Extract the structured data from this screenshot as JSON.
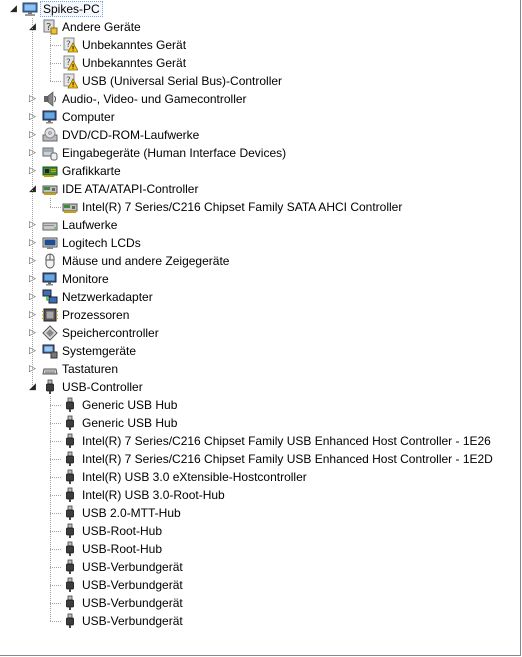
{
  "root": {
    "label": "Spikes-PC",
    "icon": "computer-icon"
  },
  "categories": [
    {
      "label": "Andere Geräte",
      "icon": "unknown-device-icon",
      "expanded": true,
      "children": [
        {
          "label": "Unbekanntes Gerät",
          "icon": "warning-device-icon"
        },
        {
          "label": "Unbekanntes Gerät",
          "icon": "warning-device-icon"
        },
        {
          "label": "USB (Universal Serial Bus)-Controller",
          "icon": "warning-device-icon"
        }
      ]
    },
    {
      "label": "Audio-, Video- und Gamecontroller",
      "icon": "speaker-icon",
      "expanded": false
    },
    {
      "label": "Computer",
      "icon": "monitor-icon",
      "expanded": false
    },
    {
      "label": "DVD/CD-ROM-Laufwerke",
      "icon": "dvd-drive-icon",
      "expanded": false
    },
    {
      "label": "Eingabegeräte (Human Interface Devices)",
      "icon": "hid-icon",
      "expanded": false
    },
    {
      "label": "Grafikkarte",
      "icon": "display-adapter-icon",
      "expanded": false
    },
    {
      "label": "IDE ATA/ATAPI-Controller",
      "icon": "ide-controller-icon",
      "expanded": true,
      "children": [
        {
          "label": "Intel(R) 7 Series/C216 Chipset Family SATA AHCI Controller",
          "icon": "ide-controller-icon"
        }
      ]
    },
    {
      "label": "Laufwerke",
      "icon": "disk-drive-icon",
      "expanded": false
    },
    {
      "label": "Logitech LCDs",
      "icon": "lcd-icon",
      "expanded": false
    },
    {
      "label": "Mäuse und andere Zeigegeräte",
      "icon": "mouse-icon",
      "expanded": false
    },
    {
      "label": "Monitore",
      "icon": "monitor-icon",
      "expanded": false
    },
    {
      "label": "Netzwerkadapter",
      "icon": "network-adapter-icon",
      "expanded": false
    },
    {
      "label": "Prozessoren",
      "icon": "processor-icon",
      "expanded": false
    },
    {
      "label": "Speichercontroller",
      "icon": "storage-controller-icon",
      "expanded": false
    },
    {
      "label": "Systemgeräte",
      "icon": "system-device-icon",
      "expanded": false
    },
    {
      "label": "Tastaturen",
      "icon": "keyboard-icon",
      "expanded": false
    },
    {
      "label": "USB-Controller",
      "icon": "usb-plug-icon",
      "expanded": true,
      "children": [
        {
          "label": "Generic USB Hub",
          "icon": "usb-plug-icon"
        },
        {
          "label": "Generic USB Hub",
          "icon": "usb-plug-icon"
        },
        {
          "label": "Intel(R) 7 Series/C216 Chipset Family USB Enhanced Host Controller - 1E26",
          "icon": "usb-plug-icon"
        },
        {
          "label": "Intel(R) 7 Series/C216 Chipset Family USB Enhanced Host Controller - 1E2D",
          "icon": "usb-plug-icon"
        },
        {
          "label": "Intel(R) USB 3.0 eXtensible-Hostcontroller",
          "icon": "usb-plug-icon"
        },
        {
          "label": "Intel(R) USB 3.0-Root-Hub",
          "icon": "usb-plug-icon"
        },
        {
          "label": "USB 2.0-MTT-Hub",
          "icon": "usb-plug-icon"
        },
        {
          "label": "USB-Root-Hub",
          "icon": "usb-plug-icon"
        },
        {
          "label": "USB-Root-Hub",
          "icon": "usb-plug-icon"
        },
        {
          "label": "USB-Verbundgerät",
          "icon": "usb-plug-icon"
        },
        {
          "label": "USB-Verbundgerät",
          "icon": "usb-plug-icon"
        },
        {
          "label": "USB-Verbundgerät",
          "icon": "usb-plug-icon"
        },
        {
          "label": "USB-Verbundgerät",
          "icon": "usb-plug-icon"
        }
      ]
    }
  ]
}
